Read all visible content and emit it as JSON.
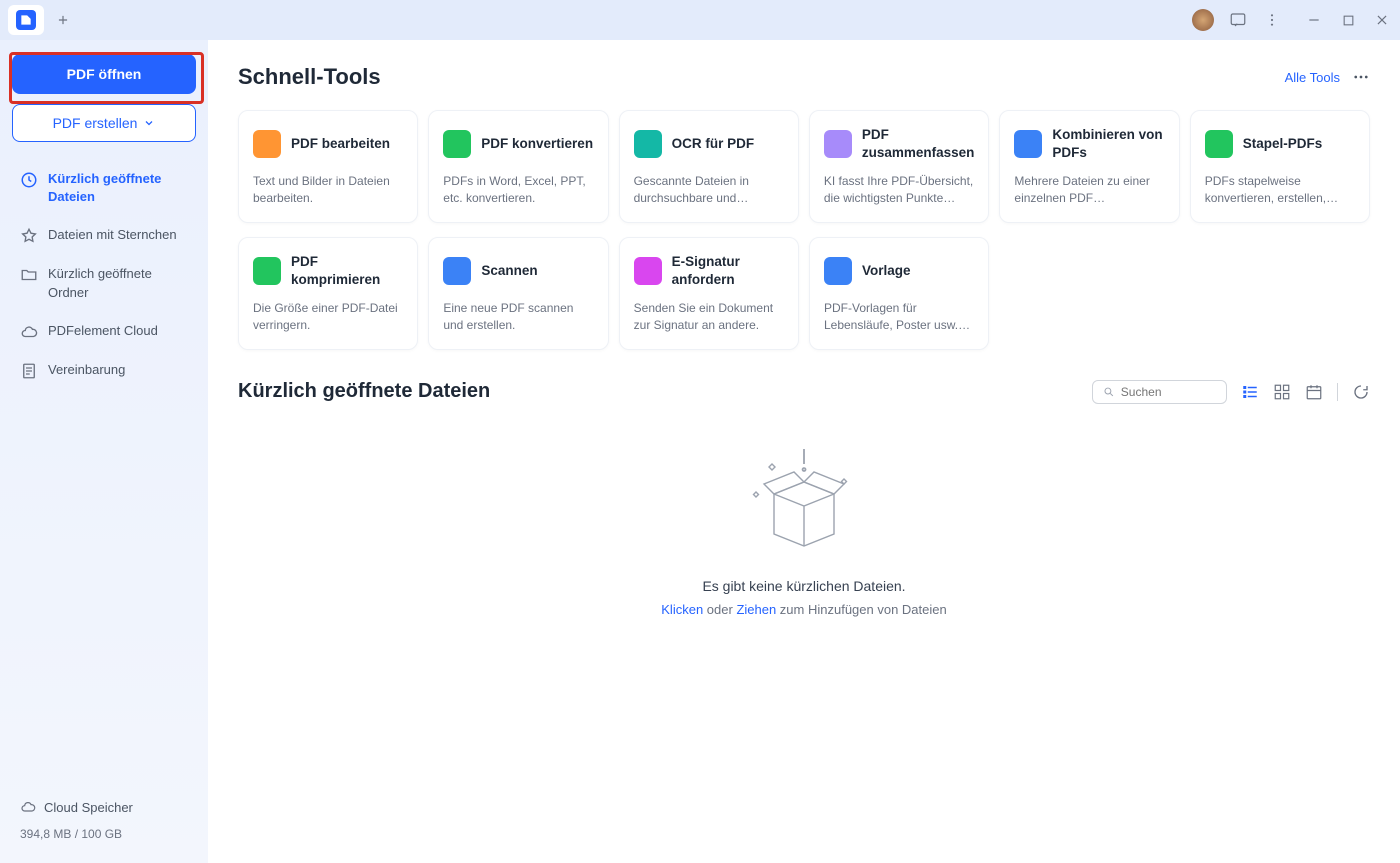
{
  "titlebar": {
    "avatar_tooltip": "Konto"
  },
  "sidebar": {
    "open_label": "PDF öffnen",
    "create_label": "PDF erstellen",
    "nav": [
      {
        "label": "Kürzlich geöffnete Dateien",
        "active": true
      },
      {
        "label": "Dateien mit Sternchen"
      },
      {
        "label": "Kürzlich geöffnete Ordner"
      },
      {
        "label": "PDFelement Cloud"
      },
      {
        "label": "Vereinbarung"
      }
    ],
    "cloud_label": "Cloud Speicher",
    "storage": "394,8 MB / 100 GB"
  },
  "quick_tools": {
    "title": "Schnell-Tools",
    "all_label": "Alle Tools",
    "row1": [
      {
        "title": "PDF bearbeiten",
        "desc": "Text und Bilder in Dateien bearbeiten.",
        "color": "#ff9533"
      },
      {
        "title": "PDF konvertieren",
        "desc": "PDFs in Word, Excel, PPT, etc. konvertieren.",
        "color": "#22c55e"
      },
      {
        "title": "OCR für PDF",
        "desc": "Gescannte Dateien in durchsuchbare und bearbeit...",
        "color": "#14b8a6"
      },
      {
        "title": "PDF zusammenfassen",
        "desc": "KI fasst Ihre PDF-Übersicht, die wichtigsten Punkte usw....",
        "color": "#a78bfa"
      },
      {
        "title": "Kombinieren von PDFs",
        "desc": "Mehrere Dateien zu einer einzelnen PDF zusammenfü...",
        "color": "#3b82f6"
      },
      {
        "title": "Stapel-PDFs",
        "desc": "PDFs stapelweise konvertieren, erstellen, druc...",
        "color": "#22c55e"
      }
    ],
    "row2": [
      {
        "title": "PDF komprimieren",
        "desc": "Die Größe einer PDF-Datei verringern.",
        "color": "#22c55e"
      },
      {
        "title": "Scannen",
        "desc": "Eine neue PDF scannen und erstellen.",
        "color": "#3b82f6"
      },
      {
        "title": "E-Signatur anfordern",
        "desc": "Senden Sie ein Dokument zur Signatur an andere.",
        "color": "#d946ef"
      },
      {
        "title": "Vorlage",
        "desc": "PDF-Vorlagen für Lebensläufe, Poster usw. erh...",
        "color": "#3b82f6"
      }
    ]
  },
  "recent": {
    "title": "Kürzlich geöffnete Dateien",
    "search_placeholder": "Suchen",
    "empty_title": "Es gibt keine kürzlichen Dateien.",
    "empty_click": "Klicken",
    "empty_or": " oder ",
    "empty_drag": "Ziehen",
    "empty_tail": " zum Hinzufügen von Dateien"
  }
}
